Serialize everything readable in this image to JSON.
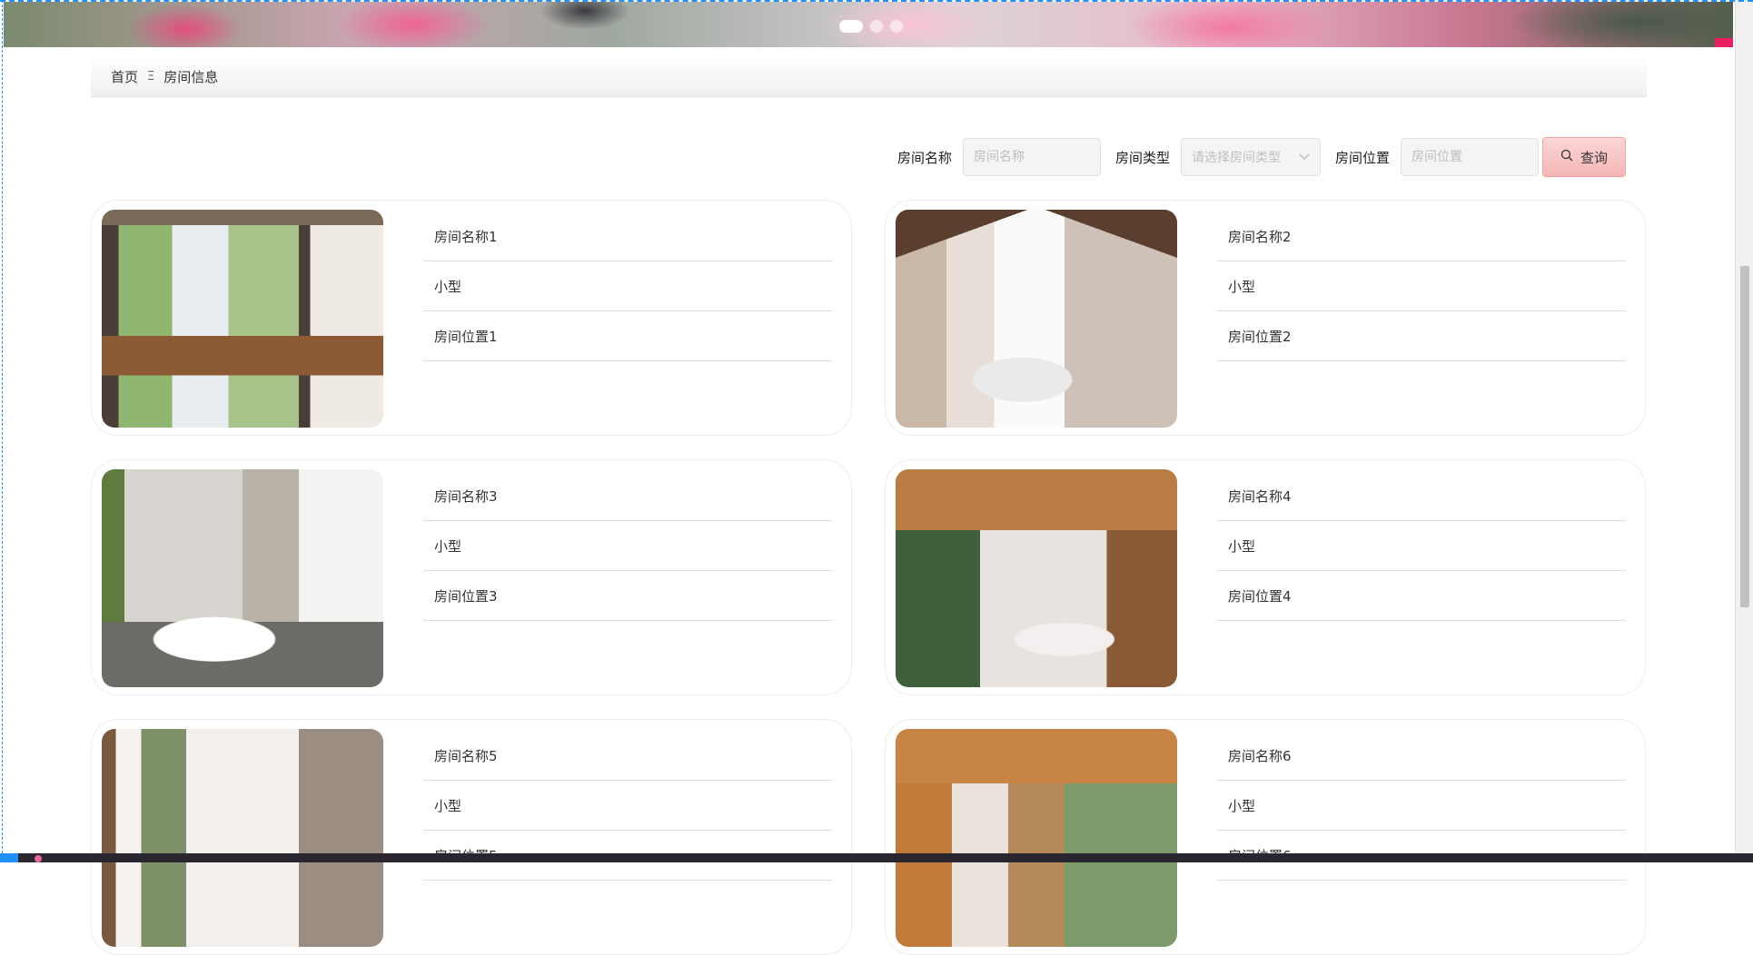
{
  "breadcrumb": {
    "home": "首页",
    "separator": "Ξ",
    "current": "房间信息"
  },
  "search": {
    "name_label": "房间名称",
    "name_placeholder": "房间名称",
    "type_label": "房间类型",
    "type_placeholder": "请选择房间类型",
    "location_label": "房间位置",
    "location_placeholder": "房间位置",
    "button_label": "查询"
  },
  "carousel": {
    "slides": 3,
    "active": 1
  },
  "rooms": [
    {
      "name": "房间名称1",
      "type": "小型",
      "location": "房间位置1"
    },
    {
      "name": "房间名称2",
      "type": "小型",
      "location": "房间位置2"
    },
    {
      "name": "房间名称3",
      "type": "小型",
      "location": "房间位置3"
    },
    {
      "name": "房间名称4",
      "type": "小型",
      "location": "房间位置4"
    },
    {
      "name": "房间名称5",
      "type": "小型",
      "location": "房间位置5"
    },
    {
      "name": "房间名称6",
      "type": "小型",
      "location": "房间位置6"
    }
  ],
  "colors": {
    "search_button": "#f6b6b6",
    "selection_outline": "#1e90ff",
    "banner_accent": "#e91e63"
  }
}
